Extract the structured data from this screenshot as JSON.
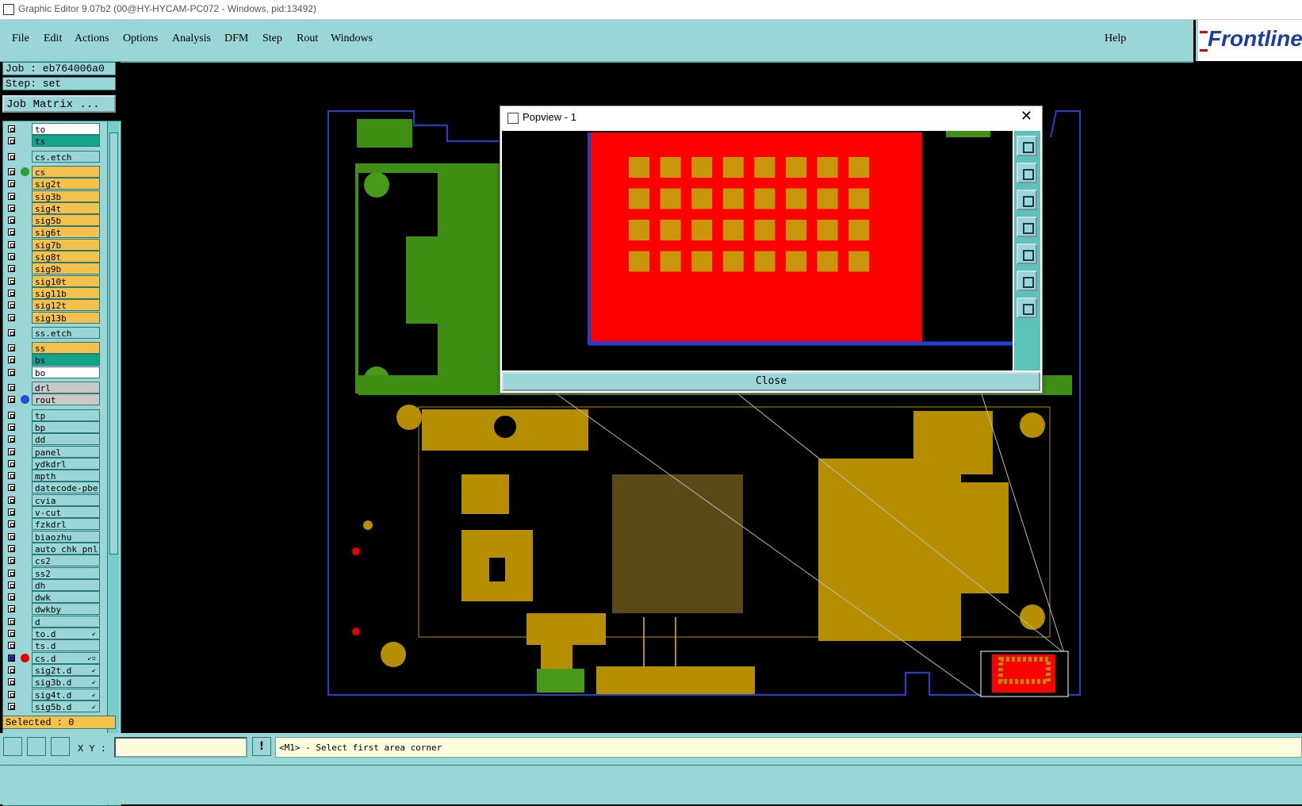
{
  "window": {
    "title": "Graphic Editor 9.07b2 (00@HY-HYCAM-PC072 - Windows, pid:13492)"
  },
  "menu": {
    "items": [
      "File",
      "Edit",
      "Actions",
      "Options",
      "Analysis",
      "DFM",
      "Step",
      "Rout",
      "Windows"
    ],
    "help": "Help"
  },
  "logo": {
    "text": "Frontline"
  },
  "job": {
    "label": "Job : eb764006a0",
    "step": "Step: set",
    "matrix_button": "Job Matrix ..."
  },
  "layers": [
    {
      "name": "to",
      "color": "#ffffff"
    },
    {
      "name": "ts",
      "color": "#12a58a"
    },
    {
      "name": "cs.etch",
      "color": "#9bd6d6",
      "gap": true
    },
    {
      "name": "cs",
      "color": "#f5c14d",
      "dot": "#2ca02c",
      "gap": true
    },
    {
      "name": "sig2t",
      "color": "#f5c14d"
    },
    {
      "name": "sig3b",
      "color": "#f5c14d"
    },
    {
      "name": "sig4t",
      "color": "#f5c14d"
    },
    {
      "name": "sig5b",
      "color": "#f5c14d"
    },
    {
      "name": "sig6t",
      "color": "#f5c14d"
    },
    {
      "name": "sig7b",
      "color": "#f5c14d"
    },
    {
      "name": "sig8t",
      "color": "#f5c14d"
    },
    {
      "name": "sig9b",
      "color": "#f5c14d"
    },
    {
      "name": "sig10t",
      "color": "#f5c14d"
    },
    {
      "name": "sig11b",
      "color": "#f5c14d"
    },
    {
      "name": "sig12t",
      "color": "#f5c14d"
    },
    {
      "name": "sig13b",
      "color": "#f5c14d"
    },
    {
      "name": "ss.etch",
      "color": "#9bd6d6",
      "gap": true
    },
    {
      "name": "ss",
      "color": "#f5c14d",
      "gap": true
    },
    {
      "name": "bs",
      "color": "#12a58a"
    },
    {
      "name": "bo",
      "color": "#ffffff"
    },
    {
      "name": "drl",
      "color": "#c8c8c8",
      "gap": true
    },
    {
      "name": "rout",
      "color": "#c8c8c8",
      "dot": "#1e4fd8"
    },
    {
      "name": "tp",
      "color": "#9bd6d6",
      "gap": true
    },
    {
      "name": "bp",
      "color": "#9bd6d6"
    },
    {
      "name": "dd",
      "color": "#9bd6d6"
    },
    {
      "name": "panel",
      "color": "#9bd6d6"
    },
    {
      "name": "ydkdrl",
      "color": "#9bd6d6"
    },
    {
      "name": "mpth",
      "color": "#9bd6d6"
    },
    {
      "name": "datecode-pbe",
      "color": "#9bd6d6"
    },
    {
      "name": "cvia",
      "color": "#9bd6d6"
    },
    {
      "name": "v-cut",
      "color": "#9bd6d6"
    },
    {
      "name": "fzkdrl",
      "color": "#9bd6d6"
    },
    {
      "name": "biaozhu",
      "color": "#9bd6d6"
    },
    {
      "name": "auto_chk_pnl",
      "color": "#9bd6d6"
    },
    {
      "name": "cs2",
      "color": "#9bd6d6"
    },
    {
      "name": "ss2",
      "color": "#9bd6d6"
    },
    {
      "name": "dh",
      "color": "#9bd6d6"
    },
    {
      "name": "dwk",
      "color": "#9bd6d6"
    },
    {
      "name": "dwkby",
      "color": "#9bd6d6"
    },
    {
      "name": "d",
      "color": "#9bd6d6"
    },
    {
      "name": "to.d",
      "color": "#9bd6d6",
      "mark": "↙"
    },
    {
      "name": "ts.d",
      "color": "#9bd6d6"
    },
    {
      "name": "cs.d",
      "color": "#9bd6d6",
      "dot": "#e00000",
      "mark": "↙▫",
      "active": true
    },
    {
      "name": "sig2t.d",
      "color": "#9bd6d6",
      "mark": "↙"
    },
    {
      "name": "sig3b.d",
      "color": "#9bd6d6",
      "mark": "↙"
    },
    {
      "name": "sig4t.d",
      "color": "#9bd6d6",
      "mark": "↙"
    },
    {
      "name": "sig5b.d",
      "color": "#9bd6d6",
      "mark": "↙"
    }
  ],
  "selected": "Selected : 0",
  "status": {
    "xy_label": "X Y :",
    "xy_value": "",
    "prompt": "<M1> - Select first area corner"
  },
  "popview": {
    "title": "Popview - 1",
    "close_button": "Close",
    "pad_rows": 4,
    "pad_cols": 8
  },
  "colors": {
    "panel": "#9bd6d6",
    "copper_top": "#4a9a1a",
    "copper_bottom": "#b58f00",
    "rout": "#1e3fd8",
    "highlight": "#ff0000"
  }
}
